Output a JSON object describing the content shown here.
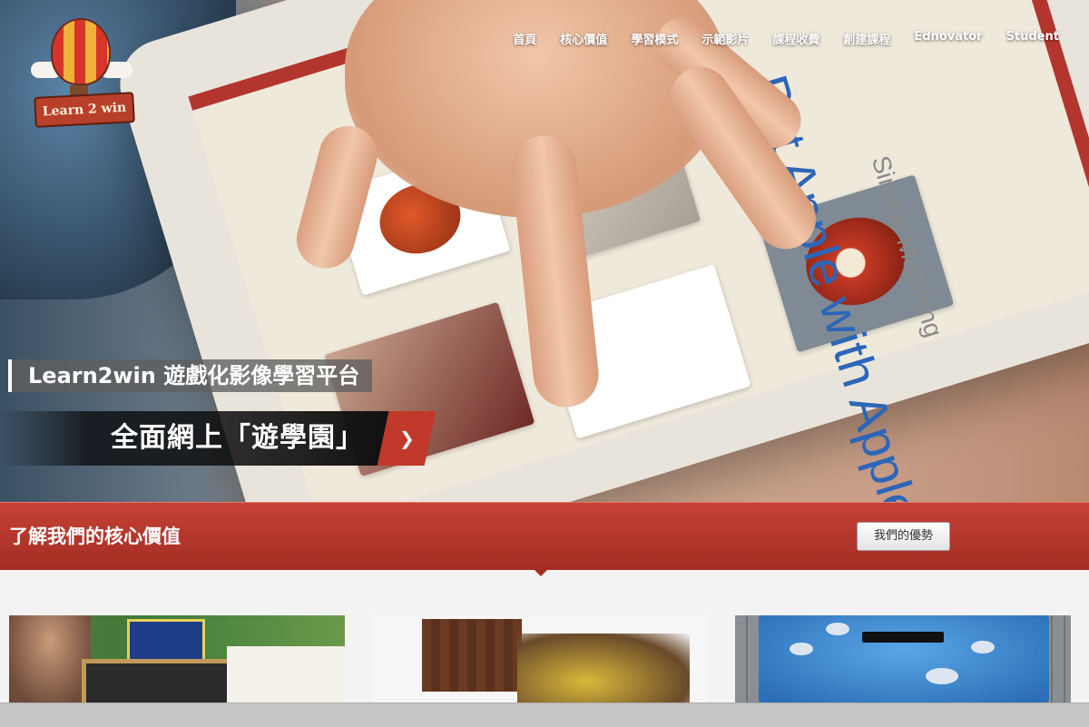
{
  "logo": {
    "text": "Learn 2 win"
  },
  "nav": {
    "items": [
      "首頁",
      "核心價值",
      "學習模式",
      "示範影片",
      "課程收費",
      "創建課程",
      "Ednovator",
      "Student"
    ]
  },
  "hero": {
    "caption_title": "Learn2win 遊戲化影像學習平台",
    "caption_subtitle": "全面網上「遊學園」",
    "arrow_icon": "chevron-right-icon",
    "tablet_screen_title": "Put Apple with Apple",
    "tablet_screen_sub": "Similar Matching"
  },
  "section": {
    "title": "了解我們的核心價值",
    "button_label": "我們的優勢"
  },
  "colors": {
    "accent_red": "#b8372c",
    "nav_text": "#ffffff"
  }
}
